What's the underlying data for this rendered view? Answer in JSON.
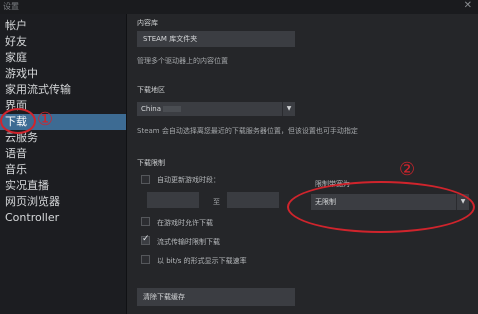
{
  "window": {
    "title": "设置",
    "close": "✕"
  },
  "sidebar": {
    "items": [
      {
        "label": "帐户"
      },
      {
        "label": "好友"
      },
      {
        "label": "家庭"
      },
      {
        "label": "游戏中"
      },
      {
        "label": "家用流式传输"
      },
      {
        "label": "界面"
      },
      {
        "label": "下载"
      },
      {
        "label": "云服务"
      },
      {
        "label": "语音"
      },
      {
        "label": "音乐"
      },
      {
        "label": "实况直播"
      },
      {
        "label": "网页浏览器"
      },
      {
        "label": "Controller"
      }
    ],
    "active_index": 6
  },
  "content": {
    "library": {
      "heading": "内容库",
      "button": "STEAM 库文件夹",
      "desc": "管理多个驱动器上的内容位置"
    },
    "region": {
      "heading": "下载地区",
      "value": "China",
      "desc": "Steam 会自动选择离您最近的下载服务器位置，但该设置也可手动指定"
    },
    "restrictions": {
      "heading": "下载限制",
      "auto_update_label": "自动更新游戏时段：",
      "to_label": "至",
      "limit_label": "限制带宽为",
      "limit_value": "无限制",
      "allow_during_game": "在游戏时允许下载",
      "throttle_streaming": "流式传输时限制下载",
      "show_bits": "以 bit/s 的形式显示下载速率"
    },
    "clear_cache": "清除下载缓存"
  },
  "annotations": {
    "one": "①",
    "two": "②"
  },
  "colors": {
    "accent": "#3d6b93",
    "annotation": "#d0242c"
  }
}
